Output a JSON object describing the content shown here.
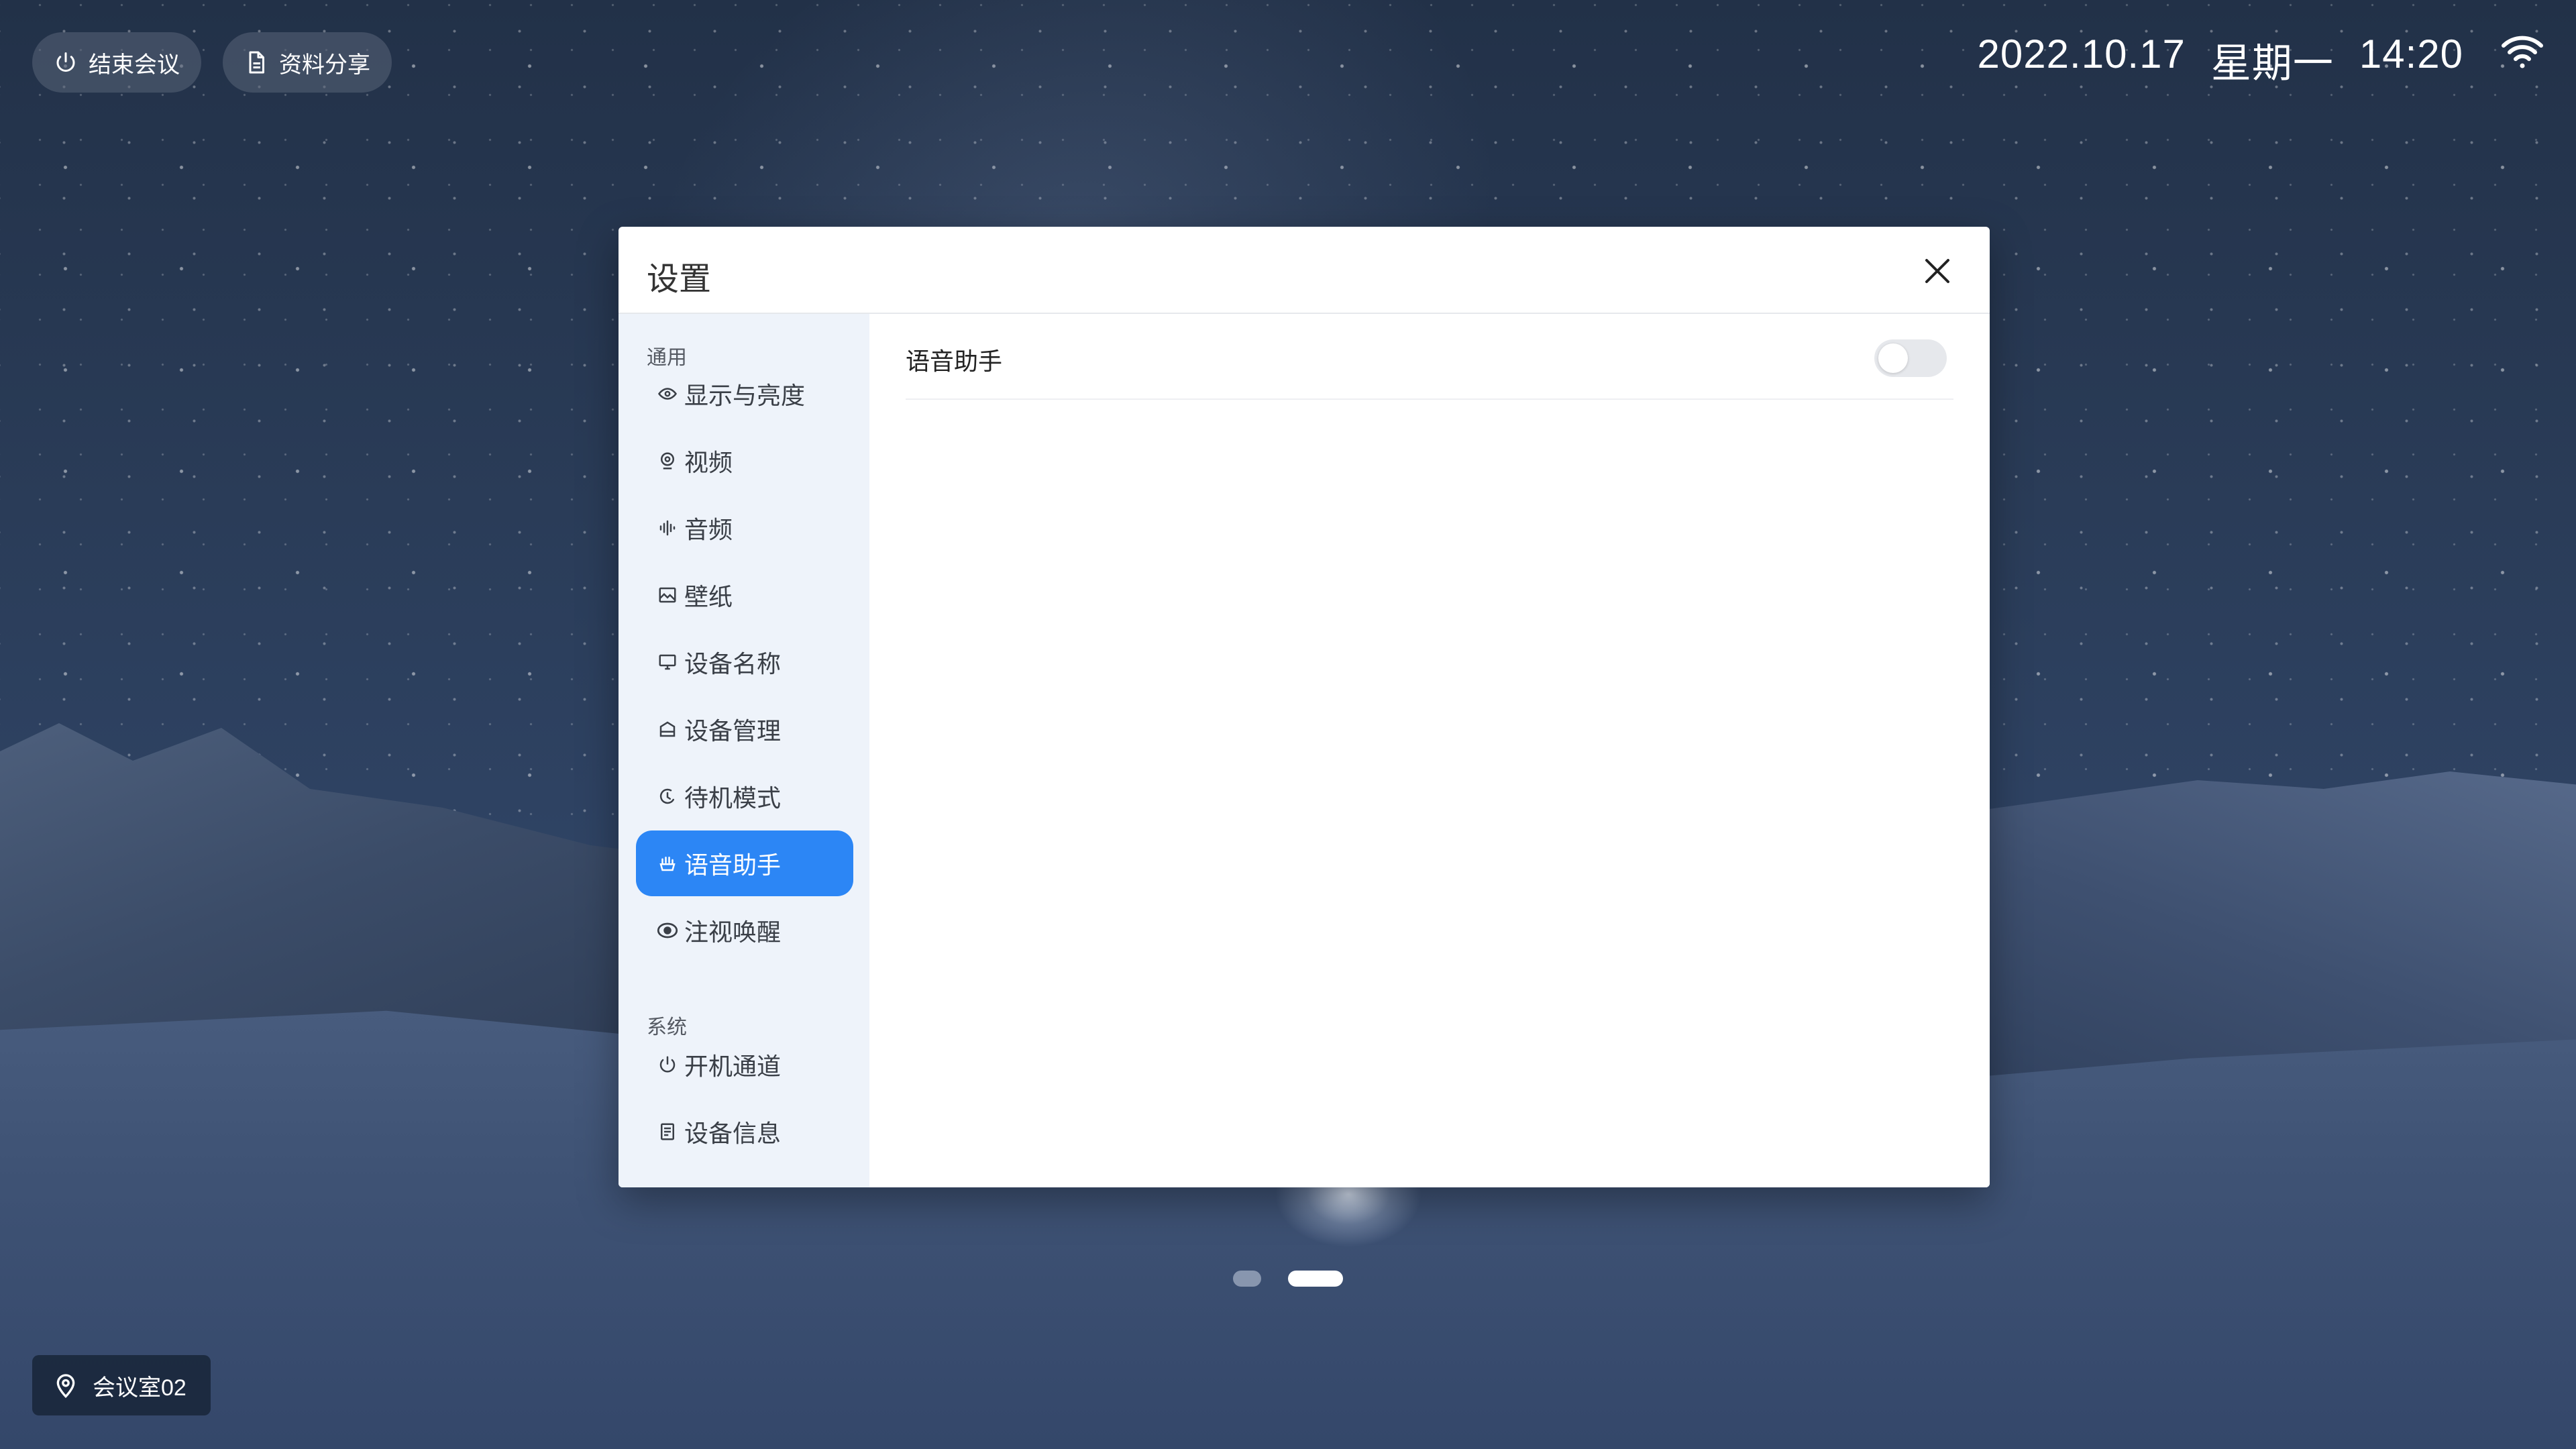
{
  "top_bar": {
    "end_meeting_label": "结束会议",
    "share_label": "资料分享",
    "date": "2022.10.17",
    "weekday": "星期一",
    "time": "14:20"
  },
  "location": {
    "room": "会议室02"
  },
  "pager": {
    "pages": 2,
    "current": 2
  },
  "dialog": {
    "title": "设置",
    "groups": [
      {
        "label": "通用",
        "items": [
          {
            "label": "显示与亮度",
            "icon": "eye-icon"
          },
          {
            "label": "视频",
            "icon": "webcam-icon"
          },
          {
            "label": "音频",
            "icon": "audio-wave-icon"
          },
          {
            "label": "壁纸",
            "icon": "image-icon"
          },
          {
            "label": "设备名称",
            "icon": "monitor-icon"
          },
          {
            "label": "设备管理",
            "icon": "device-icon"
          },
          {
            "label": "待机模式",
            "icon": "clock-icon"
          },
          {
            "label": "语音助手",
            "icon": "hand-icon"
          },
          {
            "label": "注视唤醒",
            "icon": "gaze-eye-icon"
          }
        ]
      },
      {
        "label": "系统",
        "items": [
          {
            "label": "开机通道",
            "icon": "power-icon"
          },
          {
            "label": "设备信息",
            "icon": "document-icon"
          }
        ]
      }
    ],
    "active_item": "语音助手",
    "content": {
      "voice_assistant_label": "语音助手",
      "voice_assistant_enabled": false
    }
  },
  "colors": {
    "accent": "#2c86f5",
    "sidebar_bg": "#eef3fa",
    "toggle_off": "#e6e8ec"
  }
}
